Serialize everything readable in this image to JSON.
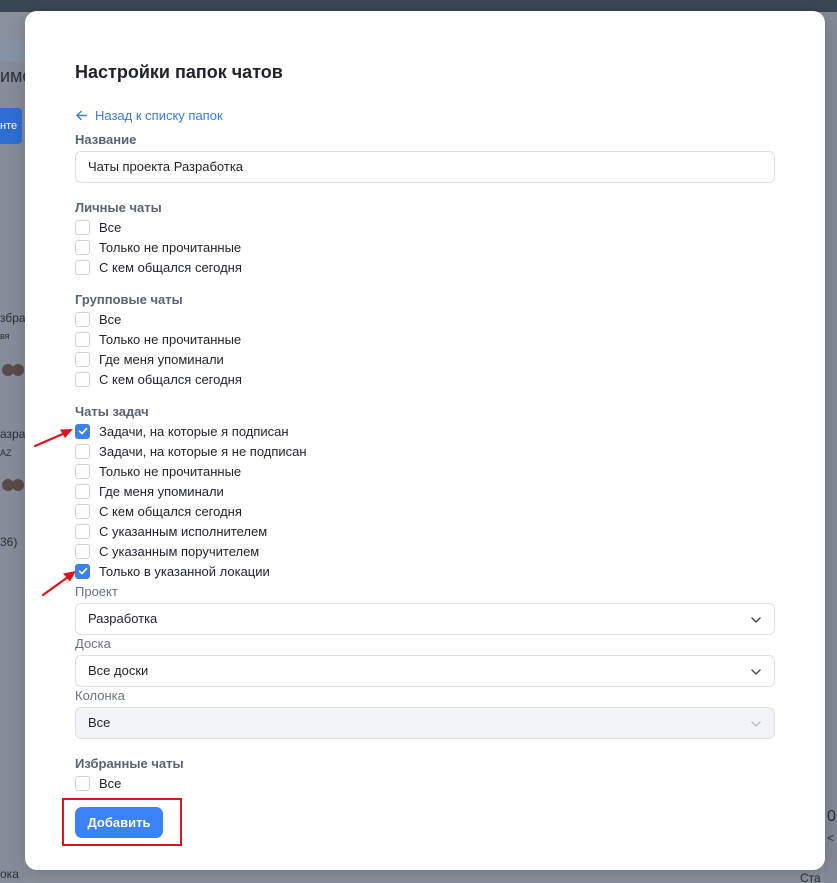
{
  "modal": {
    "title": "Настройки папок чатов",
    "back_link": "Назад к списку папок",
    "name_label": "Название",
    "name_value": "Чаты проекта Разработка",
    "personal": {
      "heading": "Личные чаты",
      "items": [
        {
          "label": "Все",
          "checked": false
        },
        {
          "label": "Только не прочитанные",
          "checked": false
        },
        {
          "label": "С кем общался сегодня",
          "checked": false
        }
      ]
    },
    "group": {
      "heading": "Групповые чаты",
      "items": [
        {
          "label": "Все",
          "checked": false
        },
        {
          "label": "Только не прочитанные",
          "checked": false
        },
        {
          "label": "Где меня упоминали",
          "checked": false
        },
        {
          "label": "С кем общался сегодня",
          "checked": false
        }
      ]
    },
    "tasks": {
      "heading": "Чаты задач",
      "items": [
        {
          "label": "Задачи, на которые я подписан",
          "checked": true
        },
        {
          "label": "Задачи, на которые я не подписан",
          "checked": false
        },
        {
          "label": "Только не прочитанные",
          "checked": false
        },
        {
          "label": "Где меня упоминали",
          "checked": false
        },
        {
          "label": "С кем общался сегодня",
          "checked": false
        },
        {
          "label": "С указанным исполнителем",
          "checked": false
        },
        {
          "label": "С указанным поручителем",
          "checked": false
        },
        {
          "label": "Только в указанной локации",
          "checked": true
        }
      ]
    },
    "project": {
      "label": "Проект",
      "value": "Разработка"
    },
    "board": {
      "label": "Доска",
      "value": "Все доски"
    },
    "column": {
      "label": "Колонка",
      "value": "Все",
      "disabled": true
    },
    "favorites": {
      "heading": "Избранные чаты",
      "items": [
        {
          "label": "Все",
          "checked": false
        }
      ]
    },
    "add_button": "Добавить"
  },
  "colors": {
    "accent": "#3b82f6",
    "annotation_red": "#e0121c"
  },
  "background": {
    "frag_1": "име",
    "frag_2": "нте",
    "frag_3": "збра",
    "frag_4": "вя",
    "frag_5": "азра",
    "frag_6": "AZ",
    "frag_7": "36)",
    "frag_8": "ока",
    "frag_9": "0",
    "frag_10": "<",
    "frag_11": "Ста"
  }
}
